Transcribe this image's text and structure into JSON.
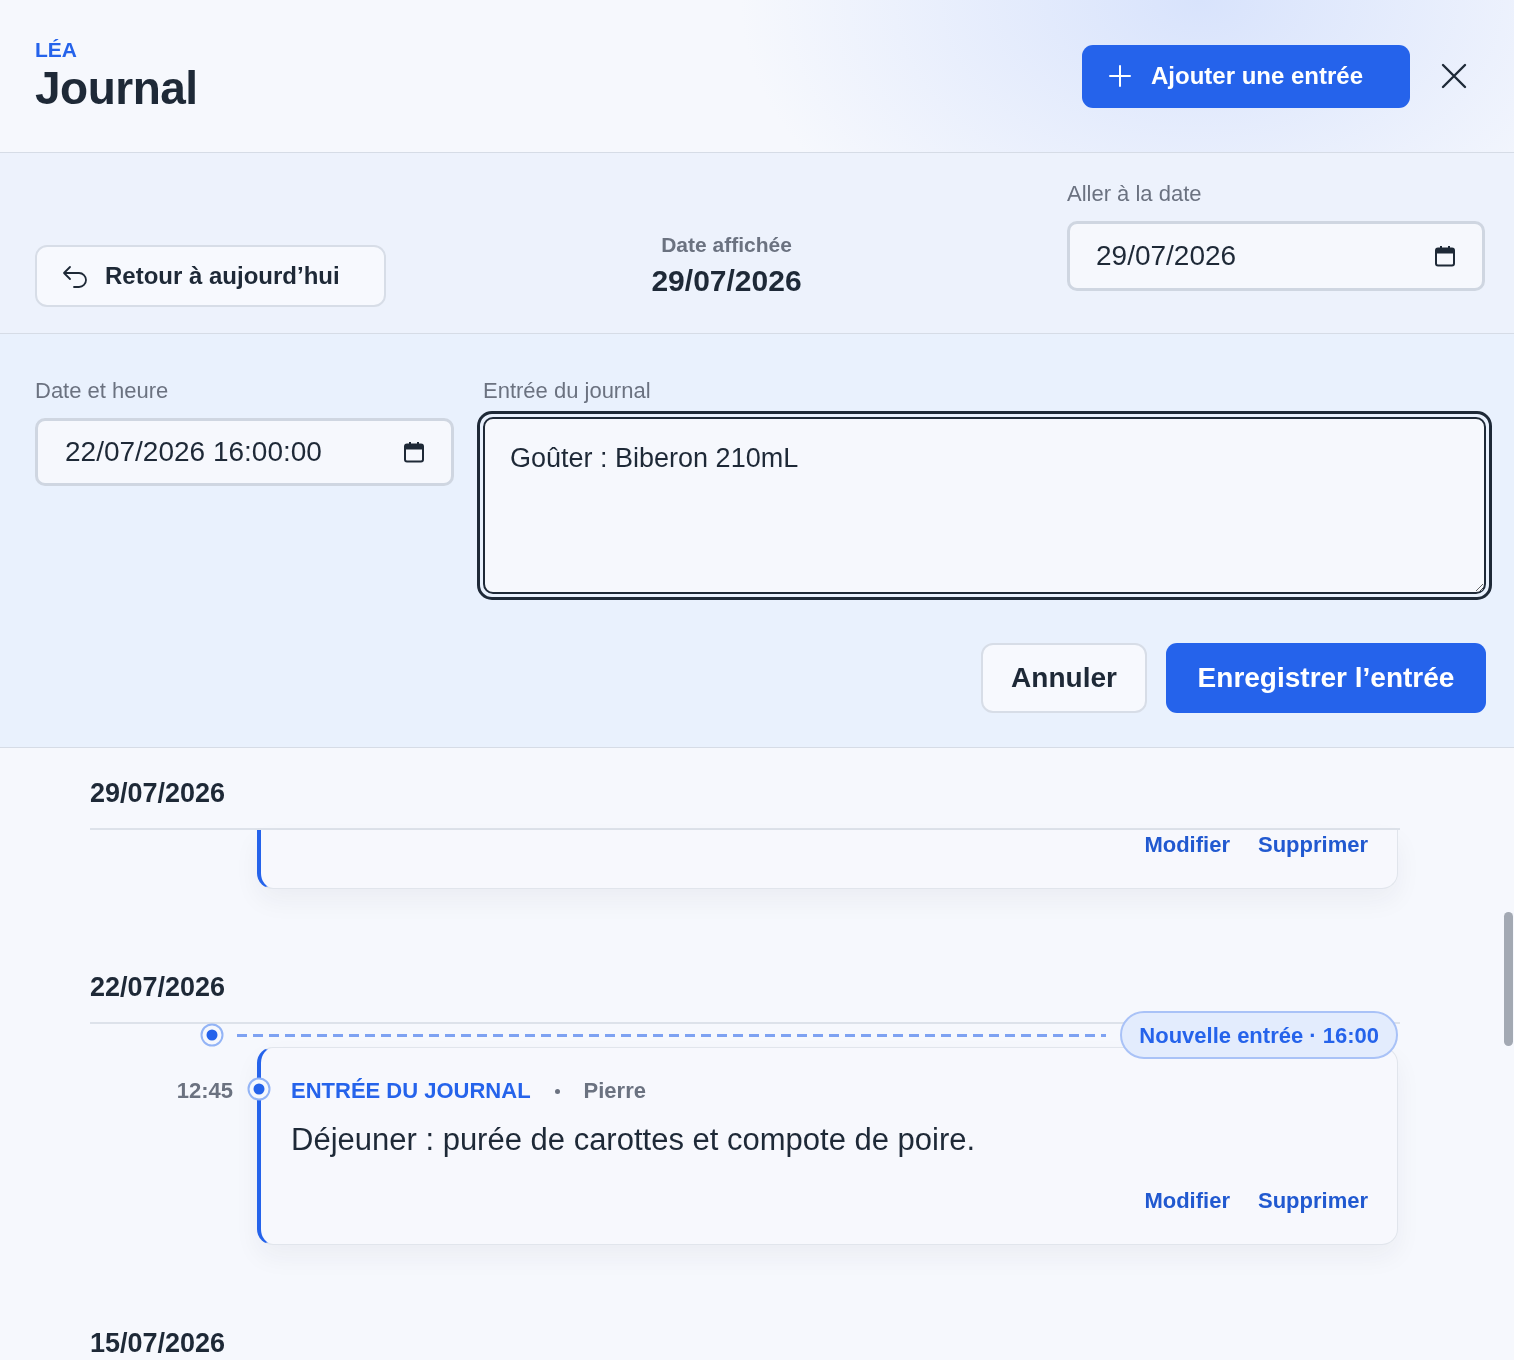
{
  "header": {
    "overline": "LÉA",
    "title": "Journal",
    "add_button": "Ajouter une entrée"
  },
  "date_nav": {
    "today_button": "Retour à aujourd’hui",
    "displayed_label": "Date affichée",
    "displayed_date": "29/07/2026",
    "goto_label": "Aller à la date",
    "goto_value": "29/07/2026"
  },
  "entry_form": {
    "datetime_label": "Date et heure",
    "datetime_value": "22/07/2026 16:00:00",
    "entry_label": "Entrée du journal",
    "entry_value": "Goûter : Biberon 210mL",
    "entry_focused": true,
    "cancel_button": "Annuler",
    "save_button": "Enregistrer l’entrée"
  },
  "timeline": {
    "days": [
      {
        "date": "29/07/2026",
        "entries": [
          {
            "kind": "partial",
            "actions": [
              "Modifier",
              "Supprimer"
            ]
          }
        ]
      },
      {
        "date": "22/07/2026",
        "new_entry_marker": "Nouvelle entrée · 16:00",
        "entries": [
          {
            "kind": "full",
            "time": "12:45",
            "type": "ENTRÉE DU JOURNAL",
            "author": "Pierre",
            "text": "Déjeuner : purée de carottes et compote de poire.",
            "actions": [
              "Modifier",
              "Supprimer"
            ]
          }
        ]
      },
      {
        "date": "15/07/2026"
      }
    ]
  }
}
